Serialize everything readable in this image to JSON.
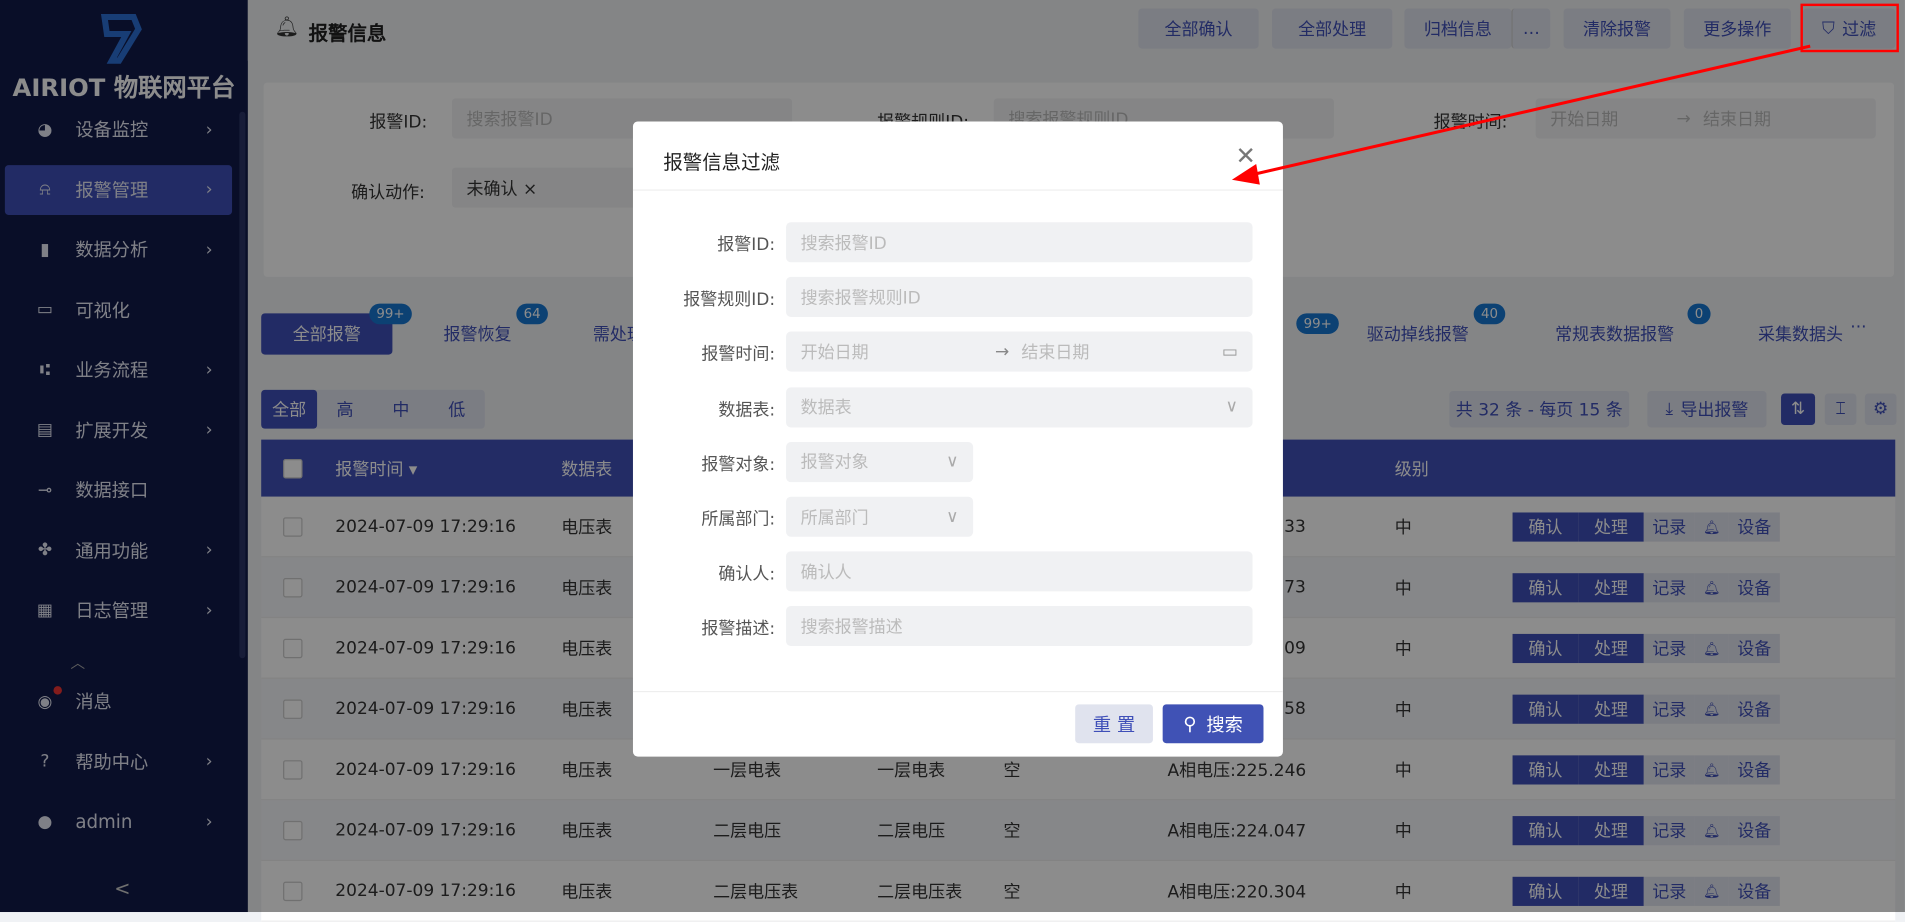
{
  "brand": {
    "name": "AIRIOT 物联网平台"
  },
  "sidebar": {
    "items": [
      {
        "label": "设备监控",
        "icon": "dashboard-icon",
        "chevron": true
      },
      {
        "label": "报警管理",
        "icon": "alarm-icon",
        "chevron": true,
        "active": true
      },
      {
        "label": "数据分析",
        "icon": "bar-chart-icon",
        "chevron": true
      },
      {
        "label": "可视化",
        "icon": "monitor-icon",
        "chevron": false
      },
      {
        "label": "业务流程",
        "icon": "flow-icon",
        "chevron": true
      },
      {
        "label": "扩展开发",
        "icon": "code-icon",
        "chevron": true
      },
      {
        "label": "数据接口",
        "icon": "plug-icon",
        "chevron": false
      },
      {
        "label": "通用功能",
        "icon": "grid-icon",
        "chevron": true
      },
      {
        "label": "日志管理",
        "icon": "log-icon",
        "chevron": true
      }
    ],
    "bottom": [
      {
        "label": "消息",
        "icon": "message-icon"
      },
      {
        "label": "帮助中心",
        "icon": "help-icon"
      },
      {
        "label": "admin",
        "icon": "user-icon"
      }
    ],
    "collapse": "<"
  },
  "header": {
    "title": "报警信息",
    "buttons": [
      "全部确认",
      "全部处理",
      "归档信息",
      "…",
      "清除报警",
      "更多操作",
      "过滤"
    ]
  },
  "filter": {
    "alarm_id": {
      "label": "报警ID:",
      "placeholder": "搜索报警ID"
    },
    "rule_id": {
      "label": "报警规则ID:",
      "placeholder": "搜索报警规则ID"
    },
    "time": {
      "label": "报警时间:",
      "start": "开始日期",
      "end": "结束日期"
    },
    "confirm": {
      "label": "确认动作:",
      "value": "未确认 ×"
    }
  },
  "tabs": [
    {
      "label": "全部报警",
      "badge": "99+"
    },
    {
      "label": "报警恢复",
      "badge": "64"
    },
    {
      "label": "需处理"
    },
    {
      "label": "",
      "badge": "99+"
    },
    {
      "label": "驱动掉线报警",
      "badge": "40"
    },
    {
      "label": "常规表数据报警",
      "badge": "0"
    },
    {
      "label": "采集数据头"
    }
  ],
  "levels": [
    "全部",
    "高",
    "中",
    "低"
  ],
  "toolbar": {
    "count": "共 32 条 - 每页 15 条",
    "export": "导出报警"
  },
  "table": {
    "headers": [
      "报警时间 ▾",
      "数据表",
      "",
      "",
      "",
      "",
      "级别"
    ],
    "actions": [
      "确认",
      "处理",
      "记录",
      "设备"
    ],
    "rows": [
      [
        "2024-07-09 17:29:16",
        "电压表",
        "",
        "",
        "",
        "33",
        "中"
      ],
      [
        "2024-07-09 17:29:16",
        "电压表",
        "",
        "",
        "",
        "73",
        "中"
      ],
      [
        "2024-07-09 17:29:16",
        "电压表",
        "",
        "",
        "",
        "09",
        "中"
      ],
      [
        "2024-07-09 17:29:16",
        "电压表",
        "",
        "",
        "",
        "58",
        "中"
      ],
      [
        "2024-07-09 17:29:16",
        "电压表",
        "一层电表",
        "一层电表",
        "空",
        "A相电压:225.246",
        "中"
      ],
      [
        "2024-07-09 17:29:16",
        "电压表",
        "二层电压",
        "二层电压",
        "空",
        "A相电压:224.047",
        "中"
      ],
      [
        "2024-07-09 17:29:16",
        "电压表",
        "二层电压表",
        "二层电压表",
        "空",
        "A相电压:220.304",
        "中"
      ]
    ]
  },
  "modal": {
    "title": "报警信息过滤",
    "fields": [
      {
        "label": "报警ID:",
        "placeholder": "搜索报警ID"
      },
      {
        "label": "报警规则ID:",
        "placeholder": "搜索报警规则ID"
      },
      {
        "label": "报警时间:",
        "start": "开始日期",
        "end": "结束日期"
      },
      {
        "label": "数据表:",
        "placeholder": "数据表"
      },
      {
        "label": "报警对象:",
        "placeholder": "报警对象"
      },
      {
        "label": "所属部门:",
        "placeholder": "所属部门"
      },
      {
        "label": "确认人:",
        "placeholder": "确认人"
      },
      {
        "label": "报警描述:",
        "placeholder": "搜索报警描述"
      }
    ],
    "reset": "重 置",
    "search": "搜索"
  },
  "colors": {
    "primary": "#4050b9",
    "sidebar": "#121b49",
    "badge": "#1677d2",
    "annotation": "#ff0000"
  }
}
